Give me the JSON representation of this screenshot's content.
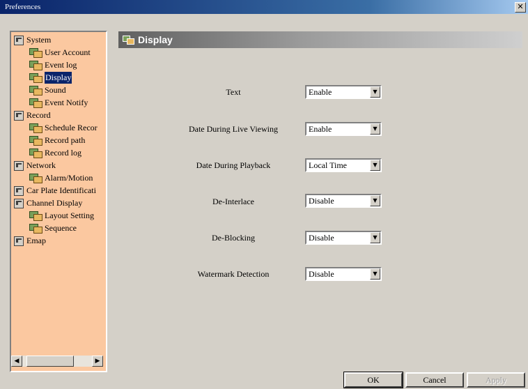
{
  "window": {
    "title": "Preferences",
    "close_glyph": "✕"
  },
  "tree": {
    "items": [
      {
        "label": "System",
        "level": 0,
        "icon": "folder-icon"
      },
      {
        "label": "User Account",
        "level": 1,
        "icon": "page-icon"
      },
      {
        "label": "Event log",
        "level": 1,
        "icon": "page-icon"
      },
      {
        "label": "Display",
        "level": 1,
        "icon": "page-icon",
        "selected": true
      },
      {
        "label": "Sound",
        "level": 1,
        "icon": "page-icon"
      },
      {
        "label": "Event Notify",
        "level": 1,
        "icon": "page-icon"
      },
      {
        "label": "Record",
        "level": 0,
        "icon": "folder-icon"
      },
      {
        "label": "Schedule Recor",
        "level": 1,
        "icon": "page-icon"
      },
      {
        "label": "Record path",
        "level": 1,
        "icon": "page-icon"
      },
      {
        "label": "Record log",
        "level": 1,
        "icon": "page-icon"
      },
      {
        "label": "Network",
        "level": 0,
        "icon": "folder-icon"
      },
      {
        "label": "Alarm/Motion",
        "level": 1,
        "icon": "page-icon"
      },
      {
        "label": "Car Plate Identificati",
        "level": 0,
        "icon": "folder-icon"
      },
      {
        "label": "Channel Display",
        "level": 0,
        "icon": "folder-icon"
      },
      {
        "label": "Layout Setting",
        "level": 1,
        "icon": "page-icon"
      },
      {
        "label": "Sequence",
        "level": 1,
        "icon": "page-icon"
      },
      {
        "label": "Emap",
        "level": 0,
        "icon": "folder-icon"
      }
    ],
    "scroll_left_glyph": "◀",
    "scroll_right_glyph": "▶"
  },
  "panel": {
    "title": "Display"
  },
  "settings": [
    {
      "label": "Text",
      "value": "Enable"
    },
    {
      "label": "Date During Live Viewing",
      "value": "Enable"
    },
    {
      "label": "Date During Playback",
      "value": "Local Time"
    },
    {
      "label": "De-Interlace",
      "value": "Disable"
    },
    {
      "label": "De-Blocking",
      "value": "Disable"
    },
    {
      "label": "Watermark Detection",
      "value": "Disable"
    }
  ],
  "dropdown_glyph": "▼",
  "buttons": {
    "ok": "OK",
    "cancel": "Cancel",
    "apply": "Apply"
  },
  "colors": {
    "tree_bg": "#fbc8a0",
    "selection": "#0a246a",
    "dialog_bg": "#d4d0c8"
  }
}
